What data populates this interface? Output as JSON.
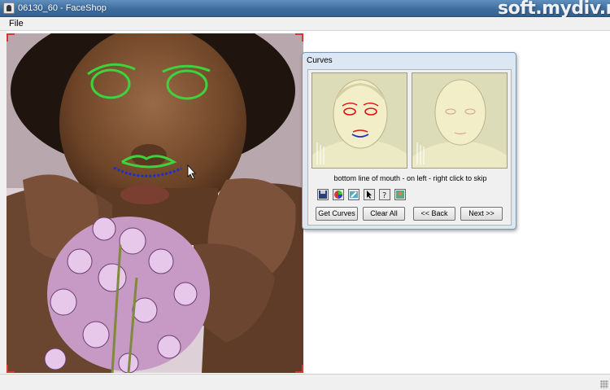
{
  "window": {
    "title": "06130_60 - FaceShop",
    "watermark": "soft.mydiv.net"
  },
  "menu": {
    "items": [
      "File"
    ]
  },
  "curves_dialog": {
    "title": "Curves",
    "instruction": "bottom line of mouth - on left - right click to skip",
    "tools": [
      "save-icon",
      "color-wheel-icon",
      "brush-icon",
      "pointer-icon",
      "help-icon",
      "image-icon"
    ],
    "buttons": {
      "get_curves": "Get Curves",
      "clear_all": "Clear All",
      "back": "<< Back",
      "next": "Next >>"
    }
  },
  "colors": {
    "eye_curve": "#3cd33c",
    "lip_curve": "#3cd33c",
    "mouth_bottom_curve": "#1a2fd0",
    "dialog_bg": "#dbe7f3",
    "corner_marker": "#d33333"
  }
}
